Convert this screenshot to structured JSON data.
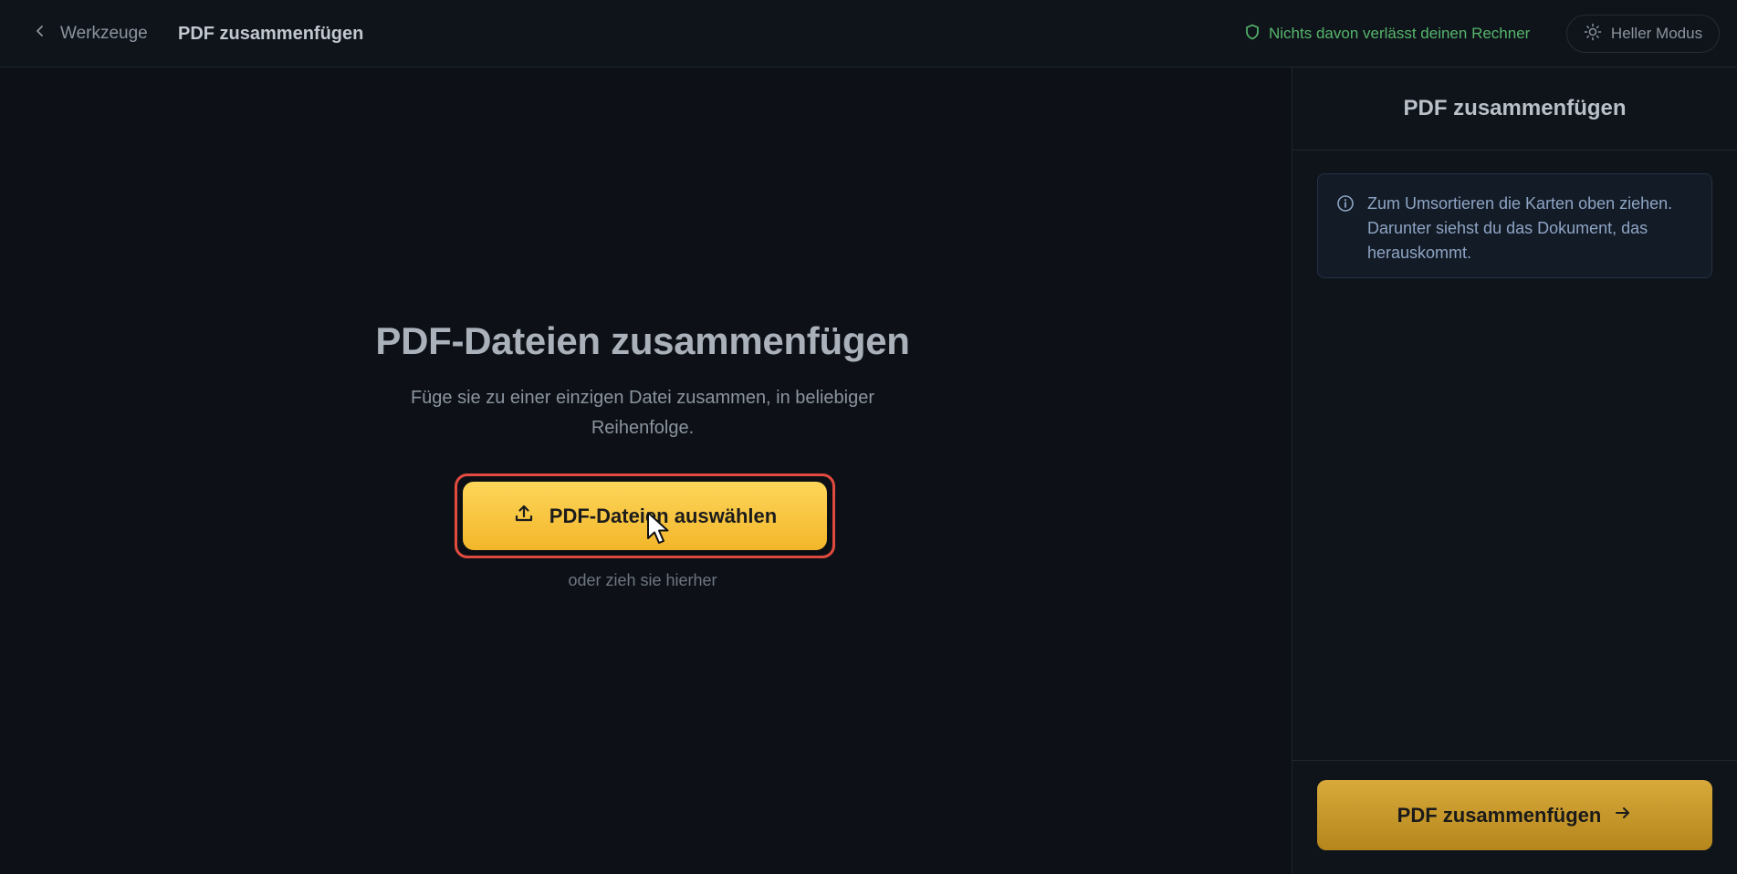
{
  "header": {
    "back_label": "Werkzeuge",
    "title": "PDF zusammenfügen",
    "privacy_note": "Nichts davon verlässt deinen Rechner",
    "theme_toggle_label": "Heller Modus"
  },
  "main": {
    "heading": "PDF-Dateien zusammenfügen",
    "subtitle": "Füge sie zu einer einzigen Datei zusammen, in beliebiger Reihenfolge.",
    "upload_button_label": "PDF-Dateien auswählen",
    "drop_hint": "oder zieh sie hierher"
  },
  "sidebar": {
    "title": "PDF zusammenfügen",
    "info_text": "Zum Umsortieren die Karten oben ziehen. Darunter siehst du das Dokument, das herauskommt.",
    "merge_button_label": "PDF zusammenfügen"
  },
  "colors": {
    "accent": "#f3b62a",
    "privacy_green": "#56b56b",
    "highlight_outline": "#e34b3f",
    "background": "#0d1117"
  },
  "icons": {
    "back": "chevron-left-icon",
    "privacy": "shield-icon",
    "theme": "sun-icon",
    "upload": "upload-icon",
    "info": "info-icon",
    "merge_arrow": "arrow-right-icon"
  }
}
